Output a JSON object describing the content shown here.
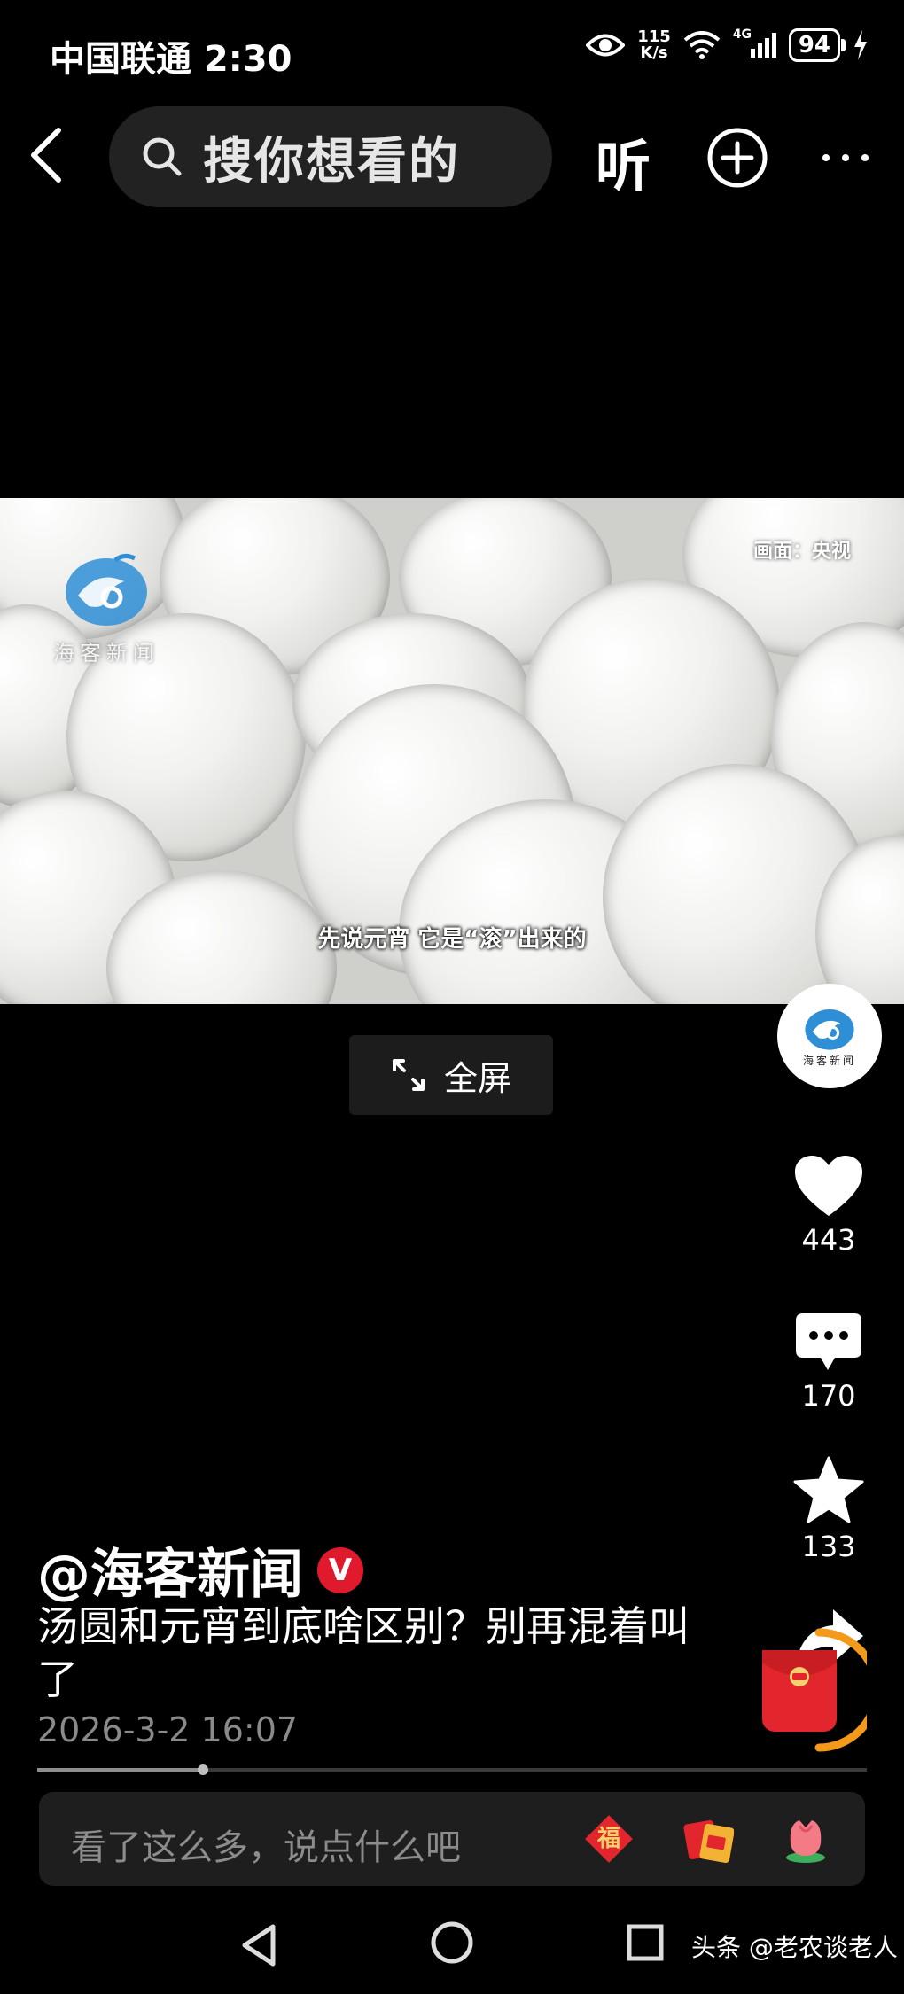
{
  "status_bar": {
    "carrier_time": "中国联通 2:30",
    "net_speed_value": "115",
    "net_speed_unit": "K/s",
    "network_type": "4G",
    "battery": "94"
  },
  "top_nav": {
    "search_placeholder": "搜你想看的",
    "listen_label": "听"
  },
  "video": {
    "watermark_text": "海客新闻",
    "source_credit": "画面：央视",
    "subtitle": "先说元宵 它是“滚”出来的",
    "fullscreen_label": "全屏"
  },
  "right_rail": {
    "avatar_text": "海客新闻",
    "likes": "443",
    "comments": "170",
    "favorites": "133"
  },
  "post": {
    "author": "@海客新闻",
    "verified_mark": "V",
    "title": "汤圆和元宵到底啥区别？别再混着叫了",
    "date": "2026-3-2 16:07",
    "progress": 0.2
  },
  "comment_bar": {
    "placeholder": "看了这么多，说点什么吧",
    "fu_char": "福"
  },
  "footer": {
    "watermark": "头条 @老农谈老人"
  },
  "colors": {
    "verified": "#e0192c",
    "red_packet": "#e3262d",
    "ring": "#f39a1b"
  }
}
